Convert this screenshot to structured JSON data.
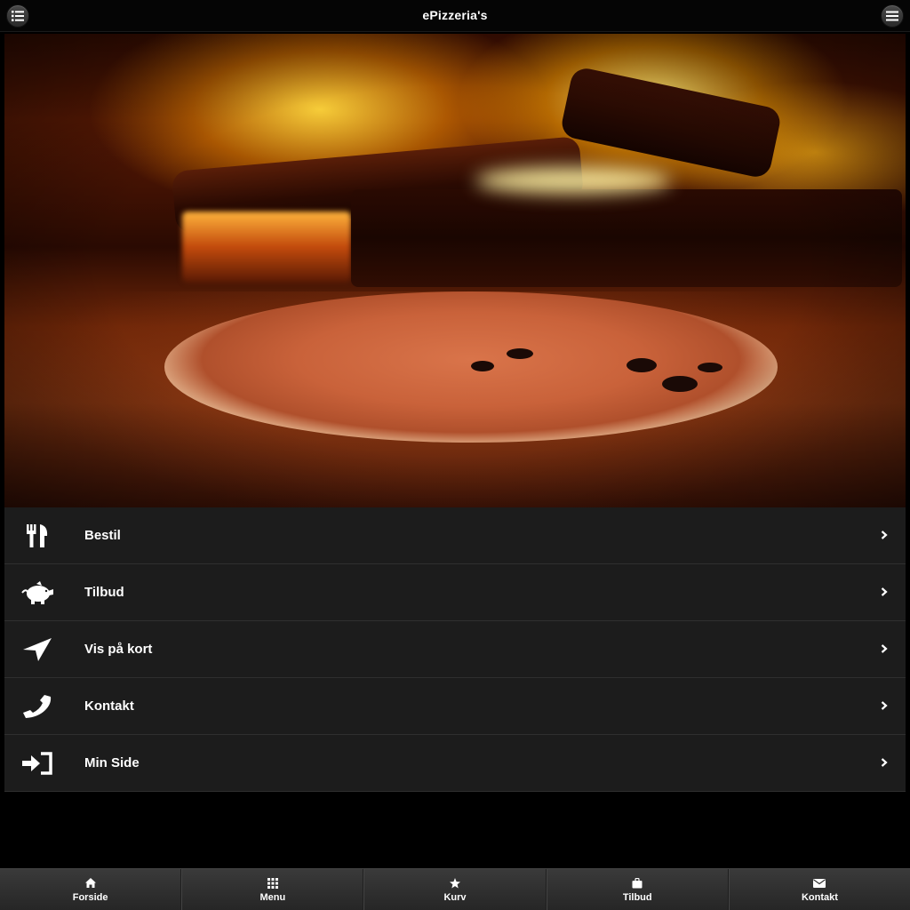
{
  "header": {
    "title": "ePizzeria's",
    "left_icon": "list-icon",
    "right_icon": "hamburger-menu-icon"
  },
  "hero": {
    "icon": "pizza-oven-photo"
  },
  "menu": {
    "items": [
      {
        "label": "Bestil",
        "icon": "cutlery-icon"
      },
      {
        "label": "Tilbud",
        "icon": "piggy-bank-icon"
      },
      {
        "label": "Vis på kort",
        "icon": "location-arrow-icon"
      },
      {
        "label": "Kontakt",
        "icon": "phone-icon"
      },
      {
        "label": "Min Side",
        "icon": "sign-in-icon"
      }
    ],
    "chevron_icon": "chevron-right-icon"
  },
  "tabbar": {
    "tabs": [
      {
        "label": "Forside",
        "icon": "home-icon"
      },
      {
        "label": "Menu",
        "icon": "grid-icon"
      },
      {
        "label": "Kurv",
        "icon": "star-icon"
      },
      {
        "label": "Tilbud",
        "icon": "bag-icon"
      },
      {
        "label": "Kontakt",
        "icon": "envelope-icon"
      }
    ]
  },
  "colors": {
    "background": "#000000",
    "list_item": "#1c1c1c",
    "tabbar": "#2d2d2d",
    "text": "#ffffff"
  }
}
